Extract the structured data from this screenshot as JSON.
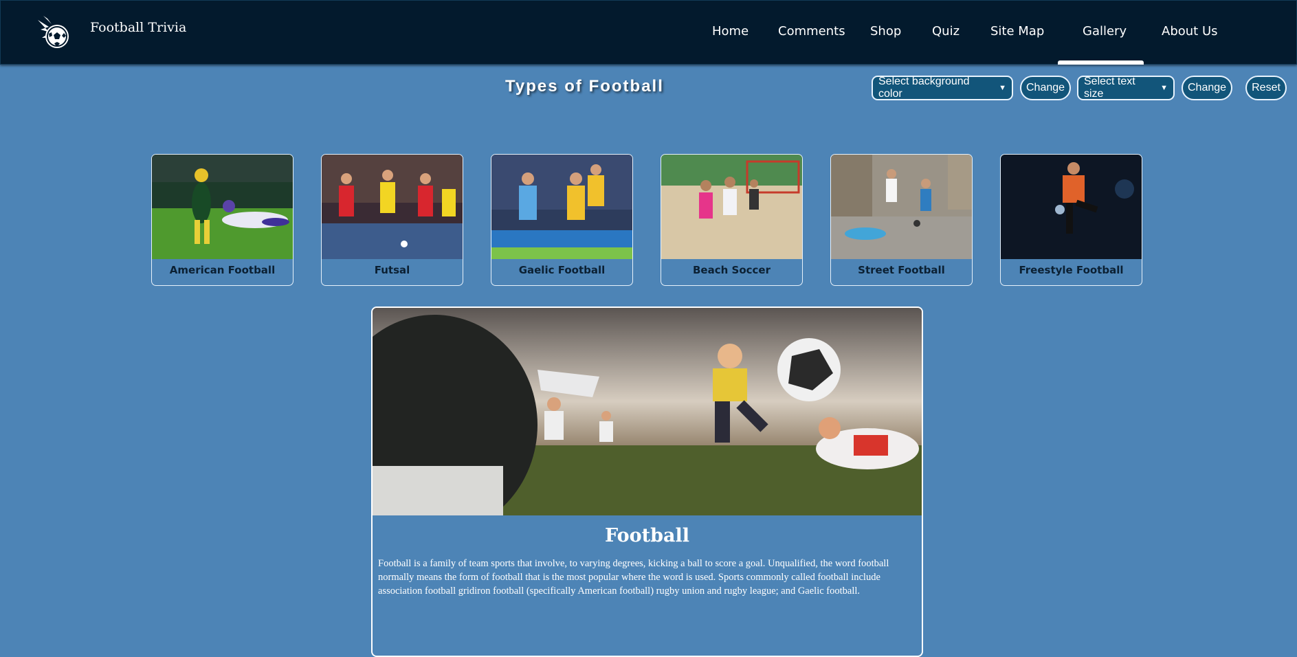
{
  "brand": {
    "name": "Football Trivia",
    "logo_icon": "flaming-football-icon"
  },
  "nav": {
    "items": [
      {
        "label": "Home"
      },
      {
        "label": "Comments"
      },
      {
        "label": "Shop"
      },
      {
        "label": "Quiz"
      },
      {
        "label": "Site Map"
      },
      {
        "label": "Gallery"
      },
      {
        "label": "About Us"
      }
    ],
    "active": "Gallery"
  },
  "page": {
    "title": "Types of Football"
  },
  "controls": {
    "bg_select": "Select background color",
    "change1": "Change",
    "size_select": "Select text size",
    "change2": "Change",
    "reset": "Reset"
  },
  "gallery": [
    {
      "label": "American Football"
    },
    {
      "label": "Futsal"
    },
    {
      "label": "Gaelic Football"
    },
    {
      "label": "Beach Soccer"
    },
    {
      "label": "Street Football"
    },
    {
      "label": "Freestyle Football"
    }
  ],
  "feature": {
    "title": "Football",
    "text": "Football is a family of team sports that involve, to varying degrees, kicking a ball to score a goal. Unqualified, the word football normally means the form of football that is the most popular where the word is used. Sports commonly called football include association football gridiron football (specifically American football) rugby union and rugby league; and Gaelic football."
  },
  "colors": {
    "page_bg": "#4d84b6",
    "nav_bg": "#031a2d",
    "button_bg": "#12557a"
  }
}
